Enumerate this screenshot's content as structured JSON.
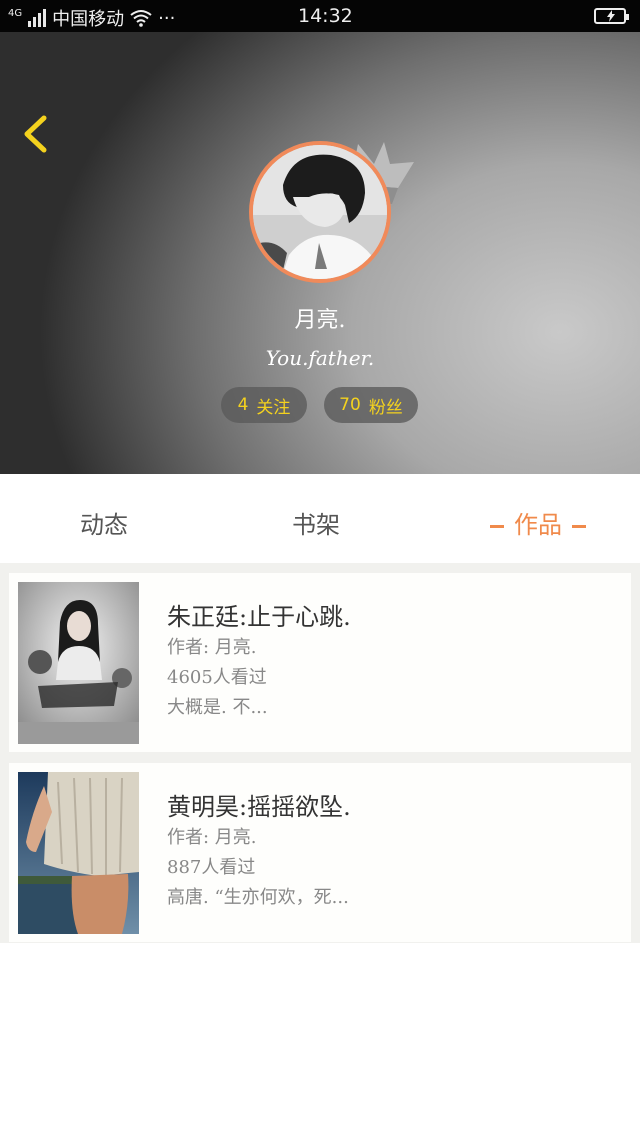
{
  "status_bar": {
    "network": "4G",
    "carrier": "中国移动",
    "more": "···",
    "time": "14:32"
  },
  "profile": {
    "nickname": "月亮.",
    "signature": "You.father.",
    "following_count": "4",
    "following_label": "关注",
    "fans_count": "70",
    "fans_label": "粉丝"
  },
  "tabs": [
    {
      "label": "动态"
    },
    {
      "label": "书架"
    },
    {
      "label": "作品",
      "active": true
    }
  ],
  "works": [
    {
      "title": "朱正廷:止于心跳.",
      "author": "作者: 月亮.",
      "views": "4605人看过",
      "excerpt": "大概是. 不..."
    },
    {
      "title": "黄明昊:摇摇欲坠.",
      "author": "作者: 月亮.",
      "views": "887人看过",
      "excerpt": "高唐. “生亦何欢，死..."
    }
  ],
  "colors": {
    "accent": "#f08a4b",
    "pill_text": "#f4d21e",
    "back_icon": "#f4d21e"
  }
}
